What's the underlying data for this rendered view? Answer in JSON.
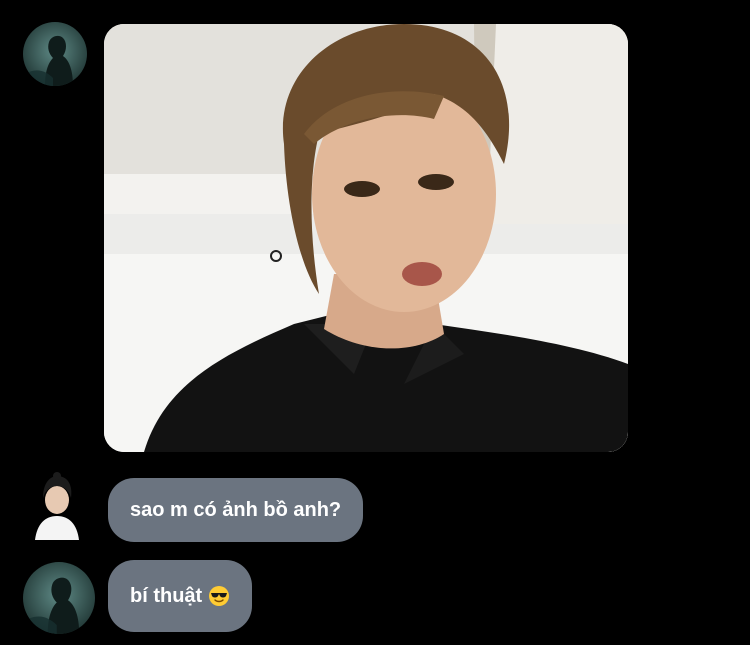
{
  "thread": {
    "messages": [
      {
        "sender": "contact-a",
        "type": "photo",
        "avatar_icon": "avatar-silhouette-icon",
        "image_icon": "photo-young-man-black-shirt-icon"
      },
      {
        "sender": "contact-b",
        "type": "text",
        "avatar_icon": "avatar-person-white-shirt-icon",
        "text": "sao m có ảnh bồ anh?"
      },
      {
        "sender": "contact-a",
        "type": "text",
        "avatar_icon": "avatar-silhouette-icon",
        "text": "bí thuật",
        "emoji_icon": "smiling-face-with-sunglasses-icon"
      }
    ]
  },
  "colors": {
    "background": "#000000",
    "bubble": "#6b7480",
    "bubble_text": "#ffffff"
  }
}
